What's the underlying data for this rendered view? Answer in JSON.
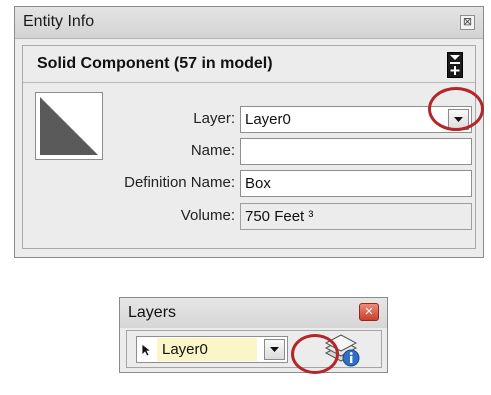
{
  "entity_info": {
    "title": "Entity Info",
    "close_label": "⊠",
    "heading": "Solid Component (57 in model)",
    "fields": {
      "layer_label": "Layer:",
      "layer_value": "Layer0",
      "name_label": "Name:",
      "name_value": "",
      "definition_label": "Definition Name:",
      "definition_value": "Box",
      "volume_label": "Volume:",
      "volume_value": "750 Feet ³"
    }
  },
  "layers_toolbar": {
    "title": "Layers",
    "close_label": "✕",
    "current_layer": "Layer0"
  },
  "colors": {
    "highlight_ring": "#b3262a",
    "active_layer_bg": "#fbf6c8",
    "close_button": "#c8402e"
  },
  "icons": [
    "close-icon",
    "expand-collapse-icon",
    "component-thumbnail-icon",
    "dropdown-arrow-icon",
    "arrow-cursor-icon",
    "layer-manager-icon"
  ]
}
